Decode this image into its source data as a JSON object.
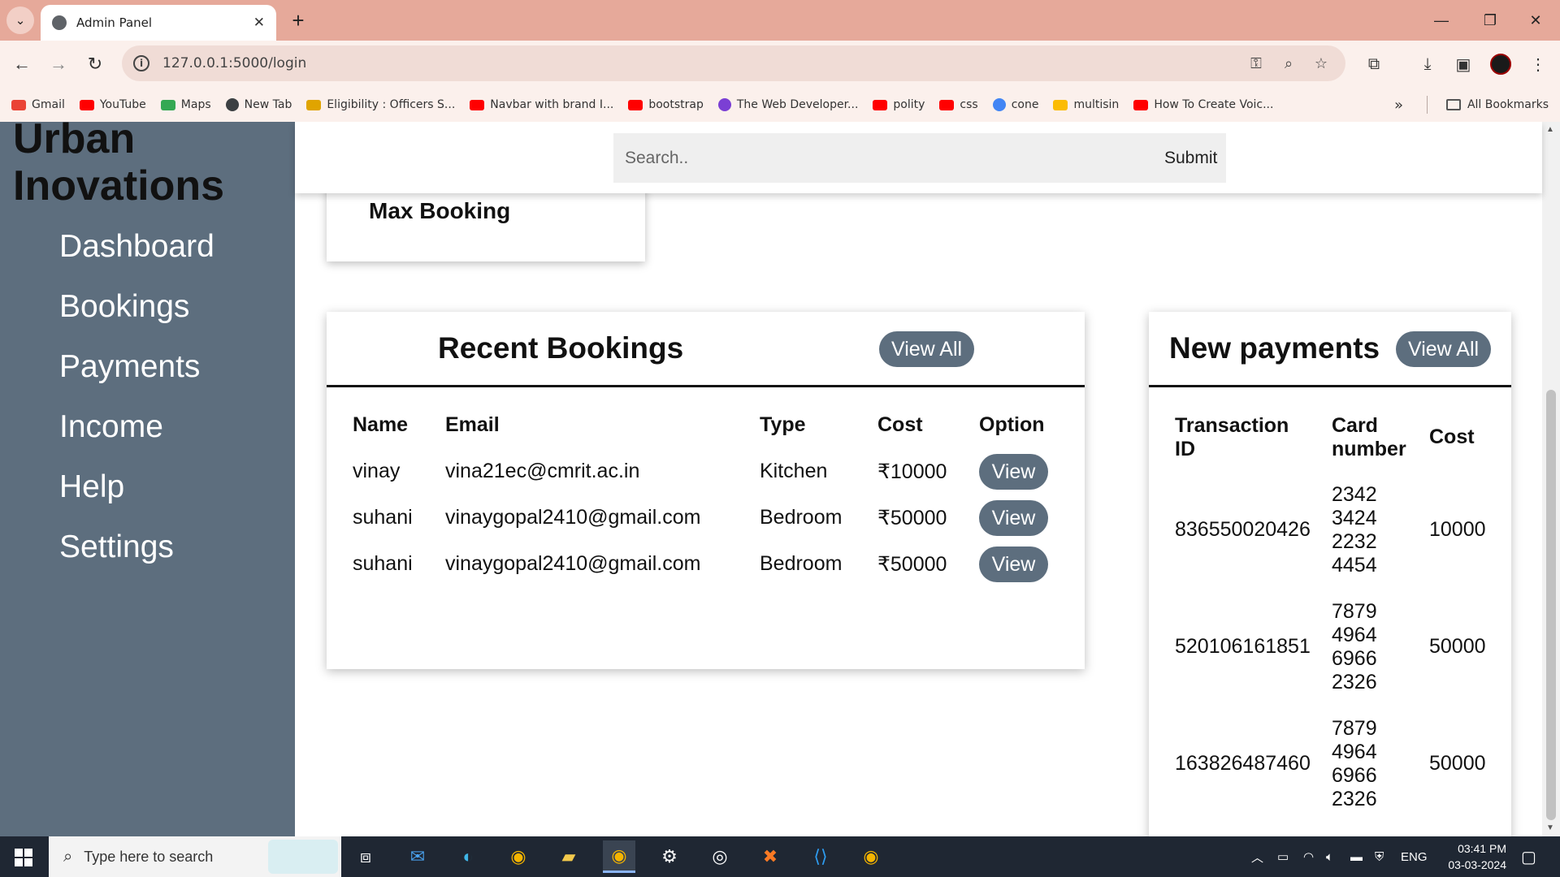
{
  "browser": {
    "tab_title": "Admin Panel",
    "url": "127.0.0.1:5000/login",
    "bookmarks": [
      {
        "label": "Gmail",
        "color": "#ea4335"
      },
      {
        "label": "YouTube",
        "color": "#ff0000"
      },
      {
        "label": "Maps",
        "color": "#34a853"
      },
      {
        "label": "New Tab",
        "color": "#3c4043"
      },
      {
        "label": "Eligibility : Officers S...",
        "color": "#e0a400"
      },
      {
        "label": "Navbar with brand I...",
        "color": "#ff0000"
      },
      {
        "label": "bootstrap",
        "color": "#ff0000"
      },
      {
        "label": "The Web Developer...",
        "color": "#7b3fd4"
      },
      {
        "label": "polity",
        "color": "#ff0000"
      },
      {
        "label": "css",
        "color": "#ff0000"
      },
      {
        "label": "cone",
        "color": "#4285f4"
      },
      {
        "label": "multisin",
        "color": "#fbbc04"
      },
      {
        "label": "How To Create Voic...",
        "color": "#ff0000"
      }
    ],
    "all_bookmarks": "All Bookmarks"
  },
  "sidebar": {
    "brand": "Urban Inovations",
    "items": [
      {
        "label": "Dashboard"
      },
      {
        "label": "Bookings"
      },
      {
        "label": "Payments"
      },
      {
        "label": "Income"
      },
      {
        "label": "Help"
      },
      {
        "label": "Settings"
      }
    ]
  },
  "search": {
    "placeholder": "Search..",
    "submit_label": "Submit"
  },
  "top_card": {
    "label": "Max Booking"
  },
  "recent_bookings": {
    "title": "Recent Bookings",
    "view_all": "View All",
    "columns": [
      "Name",
      "Email",
      "Type",
      "Cost",
      "Option"
    ],
    "rows": [
      {
        "name": "vinay",
        "email": "vina21ec@cmrit.ac.in",
        "type": "Kitchen",
        "cost": "₹10000",
        "option": "View"
      },
      {
        "name": "suhani",
        "email": "vinaygopal2410@gmail.com",
        "type": "Bedroom",
        "cost": "₹50000",
        "option": "View"
      },
      {
        "name": "suhani",
        "email": "vinaygopal2410@gmail.com",
        "type": "Bedroom",
        "cost": "₹50000",
        "option": "View"
      }
    ]
  },
  "new_payments": {
    "title": "New payments",
    "view_all": "View All",
    "columns": [
      "Transaction ID",
      "Card number",
      "Cost"
    ],
    "rows": [
      {
        "transaction_id": "836550020426",
        "card_number": [
          "2342",
          "3424",
          "2232",
          "4454"
        ],
        "cost": "10000"
      },
      {
        "transaction_id": "520106161851",
        "card_number": [
          "7879",
          "4964",
          "6966",
          "2326"
        ],
        "cost": "50000"
      },
      {
        "transaction_id": "163826487460",
        "card_number": [
          "7879",
          "4964",
          "6966",
          "2326"
        ],
        "cost": "50000"
      }
    ]
  },
  "taskbar": {
    "search_placeholder": "Type here to search",
    "language": "ENG",
    "time": "03:41 PM",
    "date": "03-03-2024"
  },
  "theme": {
    "sidebar_color": "#5d6e7e",
    "titlebar_color": "#e6a99a",
    "button_color": "#5d6e7e"
  }
}
